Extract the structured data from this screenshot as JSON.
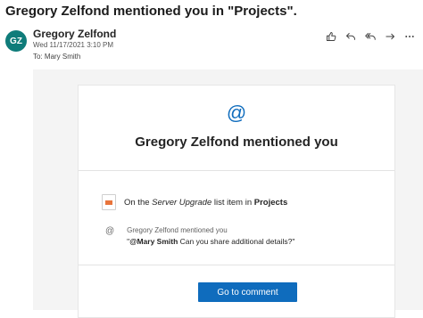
{
  "subject": "Gregory Zelfond mentioned you in \"Projects\".",
  "sender": {
    "initials": "GZ",
    "name": "Gregory Zelfond",
    "date": "Wed 11/17/2021 3:10 PM",
    "to_label": "To:",
    "to_value": "Mary Smith"
  },
  "actions": [
    {
      "name": "like",
      "icon": "thumbs-up-icon"
    },
    {
      "name": "reply",
      "icon": "reply-icon"
    },
    {
      "name": "reply-all",
      "icon": "reply-all-icon"
    },
    {
      "name": "forward",
      "icon": "forward-icon"
    },
    {
      "name": "more",
      "icon": "more-icon"
    }
  ],
  "card": {
    "icon": "@",
    "title": "Gregory Zelfond mentioned you",
    "item": {
      "prefix": "On the",
      "item_name": "Server Upgrade",
      "middle": "list item in",
      "list_name": "Projects"
    },
    "mention": {
      "icon": "@",
      "author": "Gregory Zelfond",
      "verb": "mentioned you",
      "open_quote": "\"",
      "mention_tag": "@Mary Smith",
      "message": " Can you share additional details?\""
    },
    "button": "Go to comment"
  },
  "colors": {
    "accent": "#0f6cbd",
    "avatar": "#0f7c7a",
    "list_icon": "#e8743b"
  }
}
